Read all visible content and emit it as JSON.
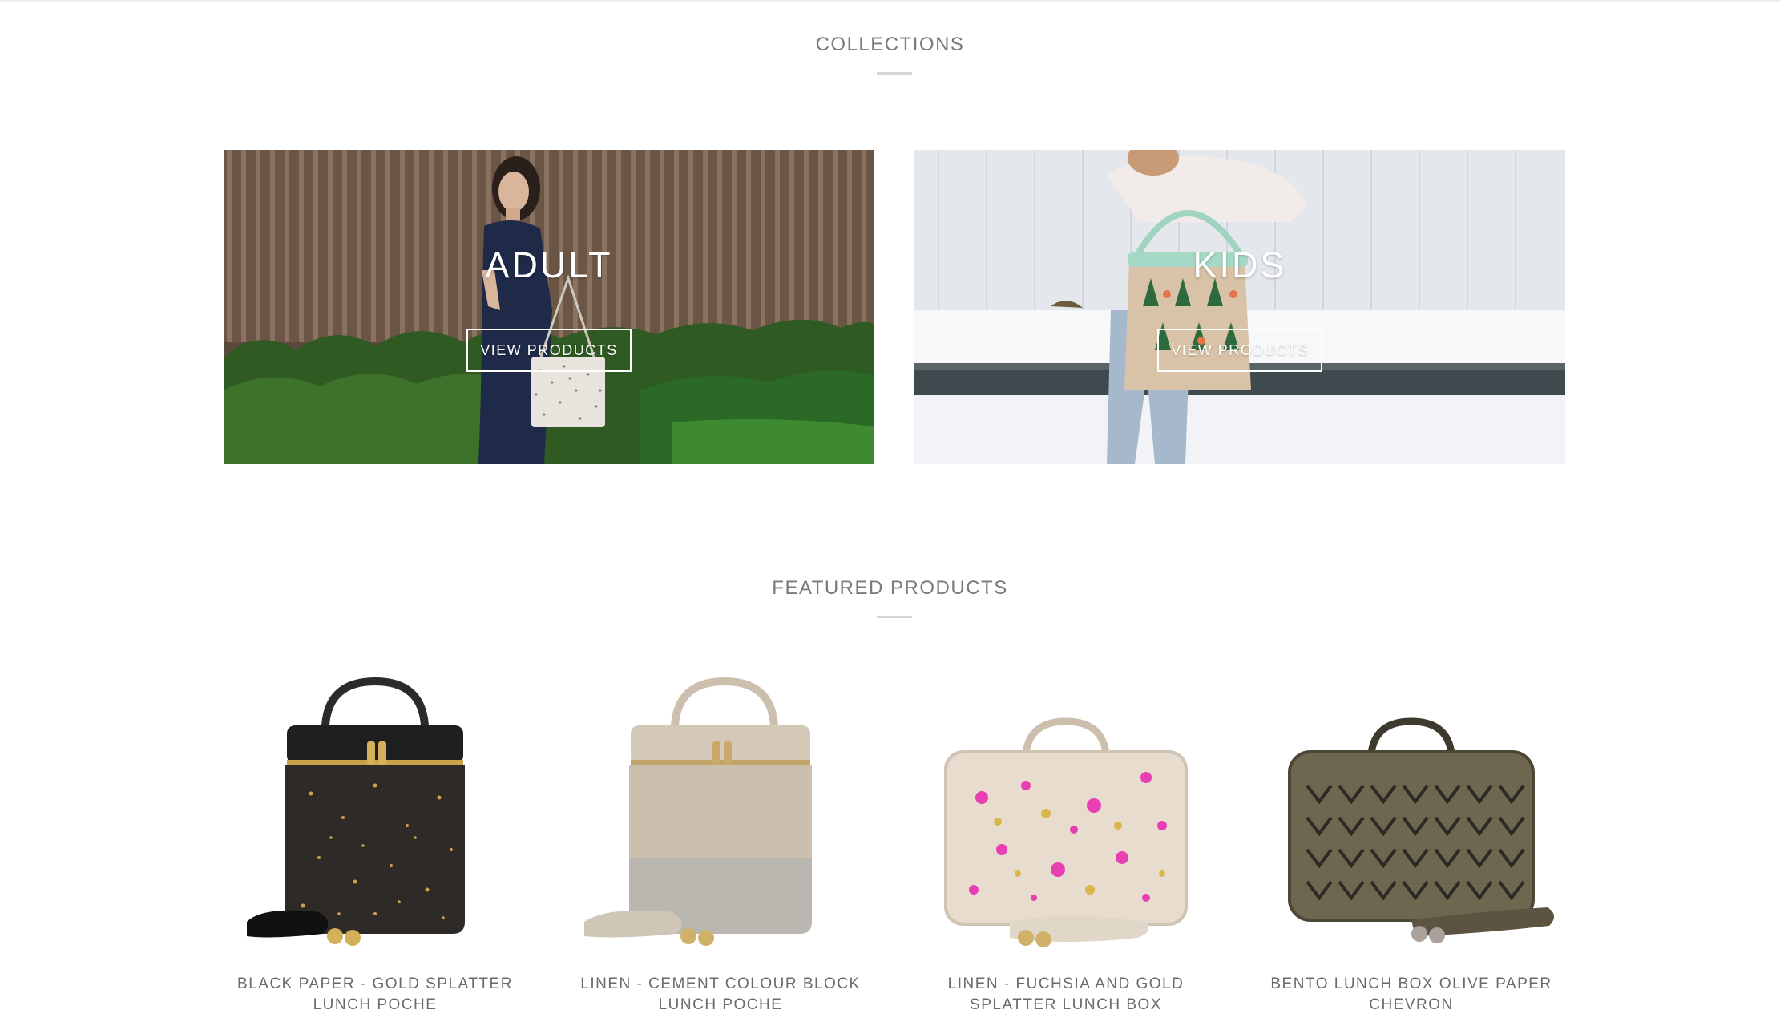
{
  "collections": {
    "title": "COLLECTIONS",
    "items": [
      {
        "name": "ADULT",
        "button_label": "VIEW PRODUCTS"
      },
      {
        "name": "KIDS",
        "button_label": "VIEW PRODUCTS"
      }
    ]
  },
  "featured": {
    "title": "FEATURED PRODUCTS",
    "products": [
      {
        "name_line1": "BLACK PAPER - GOLD SPLATTER",
        "name_line2": "LUNCH POCHE"
      },
      {
        "name_line1": "LINEN - CEMENT COLOUR BLOCK",
        "name_line2": "LUNCH POCHE"
      },
      {
        "name_line1": "LINEN - FUCHSIA AND GOLD",
        "name_line2": "SPLATTER LUNCH BOX"
      },
      {
        "name_line1": "BENTO LUNCH BOX OLIVE PAPER",
        "name_line2": "CHEVRON"
      }
    ]
  },
  "colors": {
    "heading": "#7a7a7a",
    "underline": "#d6d6d6",
    "product_text": "#6a6a6a",
    "overlay_text": "#ffffff"
  }
}
